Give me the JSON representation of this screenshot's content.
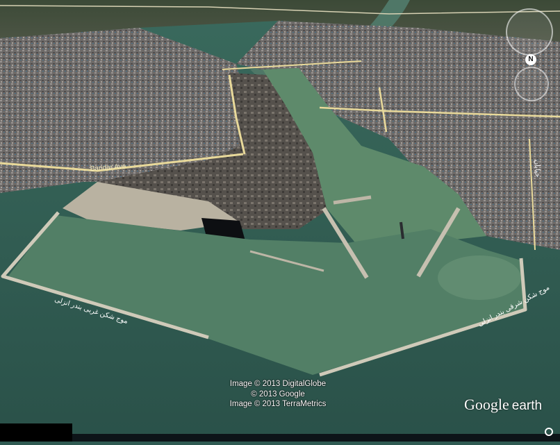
{
  "imagery": {
    "attribution": [
      "Image © 2013 DigitalGlobe",
      "© 2013 Google",
      "Image © 2013 TerraMetrics"
    ]
  },
  "logo": {
    "brand": "Google",
    "product": "earth"
  },
  "navigation": {
    "compass_label": "N"
  },
  "map_labels": {
    "road_bandar_ave": "Bandar Ave",
    "west_breakwater": "موج شکن غربی بندر انزلی",
    "east_breakwater": "موج شکن شرقی بندر انزلی",
    "road_east": "خیابان"
  },
  "colors": {
    "sea": "#2f5a52",
    "harbor_water": "#5e8a6b",
    "city": "#6f6a67",
    "roads": "#e8d99a"
  }
}
